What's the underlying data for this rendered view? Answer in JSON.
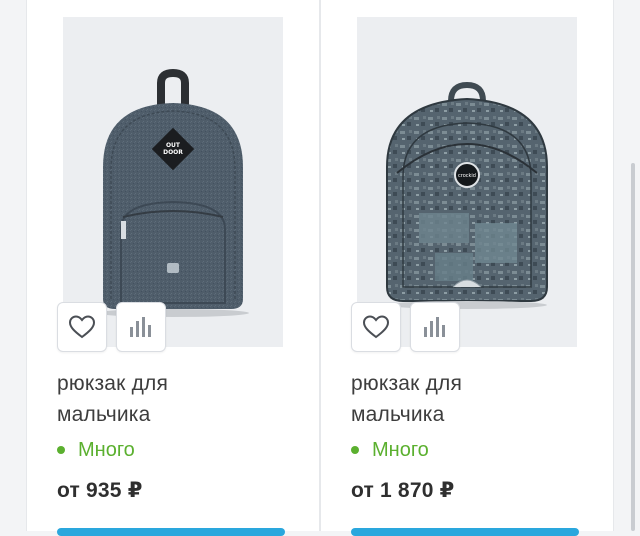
{
  "products": [
    {
      "title_line1": "рюкзак для",
      "title_line2": "мальчика",
      "stock": "Много",
      "price": "от 935 ₽",
      "image": "gray-backpack-image",
      "badge_text": [
        "OUT",
        "DOOR"
      ]
    },
    {
      "title_line1": "рюкзак для",
      "title_line2": "мальчика",
      "stock": "Много",
      "price": "от 1 870 ₽",
      "image": "camouflage-backpack-image",
      "badge_text": [
        "crockid"
      ]
    }
  ],
  "icons": {
    "favorite": "heart-icon",
    "compare": "bar-chart-icon"
  },
  "colors": {
    "in_stock": "#5bb02f",
    "accent_button": "#2aa7dd",
    "text": "#3d3d3d"
  }
}
